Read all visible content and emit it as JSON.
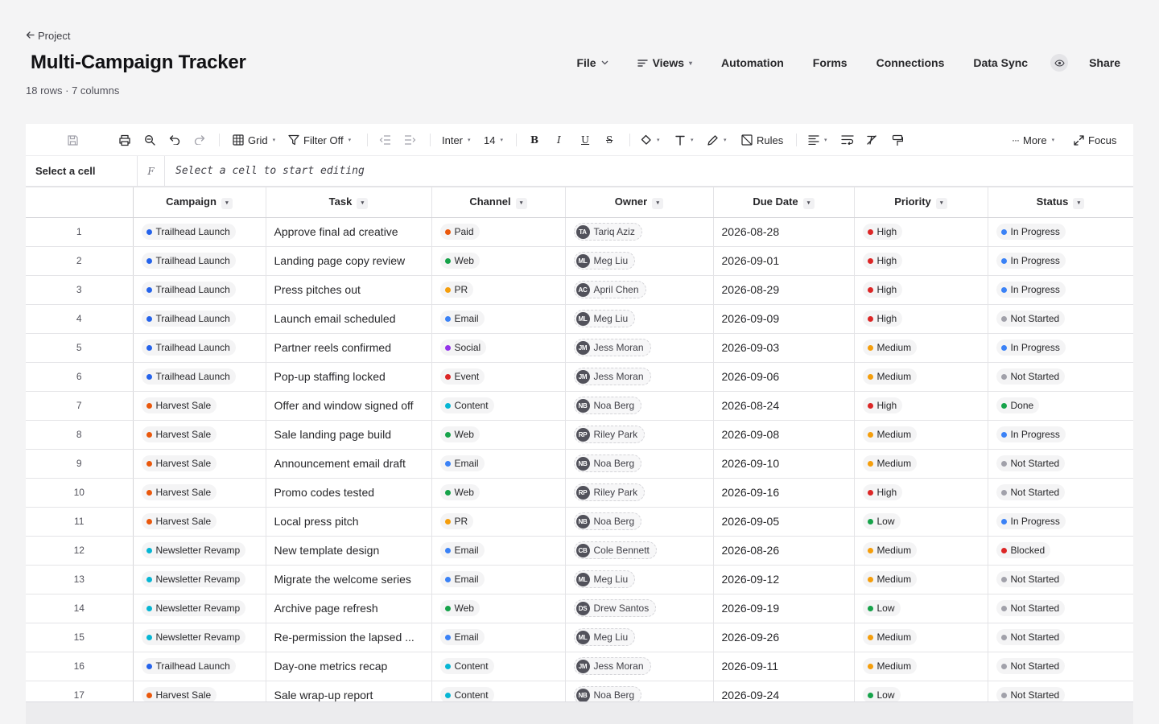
{
  "header": {
    "back_label": "Project",
    "title": "Multi-Campaign Tracker",
    "meta": "18 rows · 7 columns",
    "nav": {
      "file": "File",
      "views": "Views",
      "automation": "Automation",
      "forms": "Forms",
      "connections": "Connections",
      "data_sync": "Data Sync",
      "share": "Share"
    }
  },
  "toolbar": {
    "grid": "Grid",
    "filter": "Filter Off",
    "font": "Inter",
    "size": "14",
    "rules": "Rules",
    "more": "More",
    "focus": "Focus"
  },
  "formula_bar": {
    "cell_ref": "Select a cell",
    "fx": "F",
    "placeholder": "Select a cell to start editing"
  },
  "columns": [
    "Campaign",
    "Task",
    "Channel",
    "Owner",
    "Due Date",
    "Priority",
    "Status"
  ],
  "colors": {
    "campaign": {
      "Trailhead Launch": "#2563eb",
      "Harvest Sale": "#ea580c",
      "Newsletter Revamp": "#06b6d4"
    },
    "channel": {
      "Paid": "#ea580c",
      "Web": "#16a34a",
      "PR": "#f59e0b",
      "Email": "#3b82f6",
      "Social": "#9333ea",
      "Event": "#dc2626",
      "Content": "#06b6d4"
    },
    "priority": {
      "High": "#dc2626",
      "Medium": "#f59e0b",
      "Low": "#16a34a"
    },
    "status": {
      "In Progress": "#3b82f6",
      "Not Started": "#a1a1aa",
      "Done": "#16a34a",
      "Blocked": "#dc2626"
    }
  },
  "rows": [
    {
      "n": "1",
      "campaign": "Trailhead Launch",
      "task": "Approve final ad creative",
      "channel": "Paid",
      "initials": "TA",
      "owner": "Tariq Aziz",
      "due": "2026-08-28",
      "priority": "High",
      "status": "In Progress"
    },
    {
      "n": "2",
      "campaign": "Trailhead Launch",
      "task": "Landing page copy review",
      "channel": "Web",
      "initials": "ML",
      "owner": "Meg Liu",
      "due": "2026-09-01",
      "priority": "High",
      "status": "In Progress"
    },
    {
      "n": "3",
      "campaign": "Trailhead Launch",
      "task": "Press pitches out",
      "channel": "PR",
      "initials": "AC",
      "owner": "April Chen",
      "due": "2026-08-29",
      "priority": "High",
      "status": "In Progress"
    },
    {
      "n": "4",
      "campaign": "Trailhead Launch",
      "task": "Launch email scheduled",
      "channel": "Email",
      "initials": "ML",
      "owner": "Meg Liu",
      "due": "2026-09-09",
      "priority": "High",
      "status": "Not Started"
    },
    {
      "n": "5",
      "campaign": "Trailhead Launch",
      "task": "Partner reels confirmed",
      "channel": "Social",
      "initials": "JM",
      "owner": "Jess Moran",
      "due": "2026-09-03",
      "priority": "Medium",
      "status": "In Progress"
    },
    {
      "n": "6",
      "campaign": "Trailhead Launch",
      "task": "Pop-up staffing locked",
      "channel": "Event",
      "initials": "JM",
      "owner": "Jess Moran",
      "due": "2026-09-06",
      "priority": "Medium",
      "status": "Not Started"
    },
    {
      "n": "7",
      "campaign": "Harvest Sale",
      "task": "Offer and window signed off",
      "channel": "Content",
      "initials": "NB",
      "owner": "Noa Berg",
      "due": "2026-08-24",
      "priority": "High",
      "status": "Done"
    },
    {
      "n": "8",
      "campaign": "Harvest Sale",
      "task": "Sale landing page build",
      "channel": "Web",
      "initials": "RP",
      "owner": "Riley Park",
      "due": "2026-09-08",
      "priority": "Medium",
      "status": "In Progress"
    },
    {
      "n": "9",
      "campaign": "Harvest Sale",
      "task": "Announcement email draft",
      "channel": "Email",
      "initials": "NB",
      "owner": "Noa Berg",
      "due": "2026-09-10",
      "priority": "Medium",
      "status": "Not Started"
    },
    {
      "n": "10",
      "campaign": "Harvest Sale",
      "task": "Promo codes tested",
      "channel": "Web",
      "initials": "RP",
      "owner": "Riley Park",
      "due": "2026-09-16",
      "priority": "High",
      "status": "Not Started"
    },
    {
      "n": "11",
      "campaign": "Harvest Sale",
      "task": "Local press pitch",
      "channel": "PR",
      "initials": "NB",
      "owner": "Noa Berg",
      "due": "2026-09-05",
      "priority": "Low",
      "status": "In Progress"
    },
    {
      "n": "12",
      "campaign": "Newsletter Revamp",
      "task": "New template design",
      "channel": "Email",
      "initials": "CB",
      "owner": "Cole Bennett",
      "due": "2026-08-26",
      "priority": "Medium",
      "status": "Blocked"
    },
    {
      "n": "13",
      "campaign": "Newsletter Revamp",
      "task": "Migrate the welcome series",
      "channel": "Email",
      "initials": "ML",
      "owner": "Meg Liu",
      "due": "2026-09-12",
      "priority": "Medium",
      "status": "Not Started"
    },
    {
      "n": "14",
      "campaign": "Newsletter Revamp",
      "task": "Archive page refresh",
      "channel": "Web",
      "initials": "DS",
      "owner": "Drew Santos",
      "due": "2026-09-19",
      "priority": "Low",
      "status": "Not Started"
    },
    {
      "n": "15",
      "campaign": "Newsletter Revamp",
      "task": "Re-permission the lapsed ...",
      "channel": "Email",
      "initials": "ML",
      "owner": "Meg Liu",
      "due": "2026-09-26",
      "priority": "Medium",
      "status": "Not Started"
    },
    {
      "n": "16",
      "campaign": "Trailhead Launch",
      "task": "Day-one metrics recap",
      "channel": "Content",
      "initials": "JM",
      "owner": "Jess Moran",
      "due": "2026-09-11",
      "priority": "Medium",
      "status": "Not Started"
    },
    {
      "n": "17",
      "campaign": "Harvest Sale",
      "task": "Sale wrap-up report",
      "channel": "Content",
      "initials": "NB",
      "owner": "Noa Berg",
      "due": "2026-09-24",
      "priority": "Low",
      "status": "Not Started"
    }
  ]
}
